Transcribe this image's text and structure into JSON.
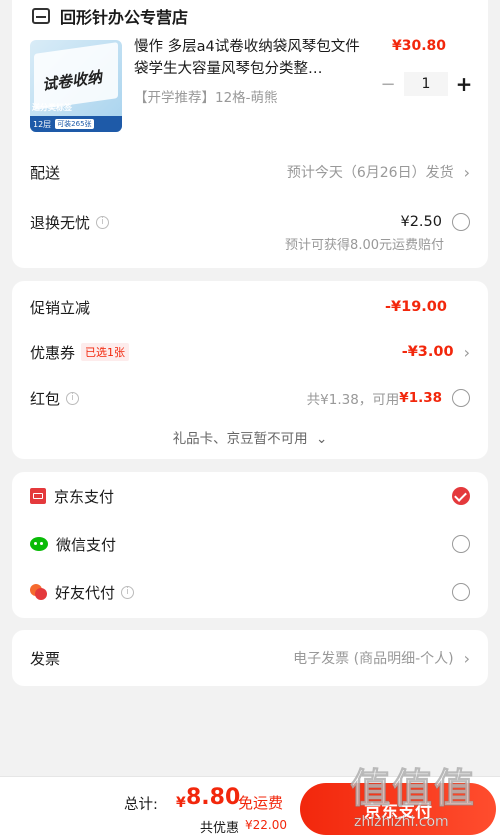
{
  "store": {
    "name": "回形针办公专营店",
    "icon": "store-icon"
  },
  "product": {
    "title": "慢作 多层a4试卷收纳袋风琴包文件袋学生大容量风琴包分类整…",
    "tag": "【开学推荐】12格-萌熊",
    "price": "¥30.80",
    "quantity": "1",
    "minus": "−",
    "plus": "+",
    "image_text": "试卷收纳",
    "image_sub": "送分类标签",
    "image_badge1": "12层",
    "image_badge2": "可装265张"
  },
  "delivery": {
    "label": "配送",
    "value": "预计今天（6月26日）发货"
  },
  "returns": {
    "label": "退换无忧",
    "price": "¥2.50",
    "note": "预计可获得8.00元运费赔付",
    "info": "i"
  },
  "promo": {
    "label": "促销立减",
    "value": "-¥19.00"
  },
  "coupon": {
    "label": "优惠券",
    "badge": "已选1张",
    "value": "-¥3.00"
  },
  "redpacket": {
    "label": "红包",
    "total": "共¥1.38，可用",
    "available": "¥1.38",
    "info": "i"
  },
  "unavailable": {
    "text": "礼品卡、京豆暂不可用",
    "chevron": "⌄"
  },
  "payments": [
    {
      "label": "京东支付",
      "icon": "jd-pay-icon",
      "selected": true
    },
    {
      "label": "微信支付",
      "icon": "wechat-icon",
      "selected": false
    },
    {
      "label": "好友代付",
      "icon": "friend-pay-icon",
      "selected": false
    }
  ],
  "friend_info": "i",
  "invoice": {
    "label": "发票",
    "value": "电子发票 (商品明细-个人)"
  },
  "footer": {
    "total_label": "总计:",
    "currency": "¥",
    "amount": "8.80",
    "shipping": "免运费",
    "discount_label": "共优惠",
    "discount": "¥22.00",
    "pay_button": "京东支付"
  },
  "watermark": {
    "chars": "值值值",
    "url": "zhizhizhi.com"
  },
  "colors": {
    "accent": "#f2270c",
    "jd_red": "#e4393c",
    "wechat": "#09bb07"
  }
}
